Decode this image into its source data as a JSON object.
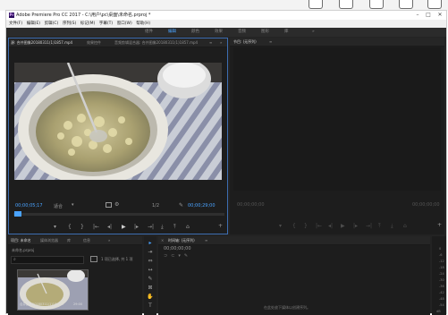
{
  "app": {
    "title": "Adobe Premiere Pro CC 2017 - C:\\用户\\pc\\桌面\\未命名.prproj *",
    "logo_text": "Pr",
    "minimize": "–",
    "maximize": "□",
    "close": "✕"
  },
  "menu": [
    "文件(F)",
    "编辑(E)",
    "剪辑(C)",
    "序列(S)",
    "标记(M)",
    "字幕(T)",
    "窗口(W)",
    "帮助(H)"
  ],
  "workspaces": {
    "items": [
      "组件",
      "编辑",
      "颜色",
      "效果",
      "音频",
      "图形",
      "库"
    ],
    "active_index": 1,
    "more": "»"
  },
  "source_panel": {
    "tabs": [
      "源: 合并图像20180311(1)1857.mp4",
      "效果控件",
      "音频剪辑混合器: 合并图像20180311(1)1857.mp4"
    ],
    "menu_icon": "≡",
    "more": "»",
    "timecode_in": "00;00;05;17",
    "fit": "适合",
    "zoom": "1/2",
    "timecode_out": "00;00;29;00",
    "controls": [
      "▾",
      "{",
      "}",
      "|←",
      "◂|",
      "▶",
      "|▸",
      "→|",
      "⤓",
      "⤒",
      "⌂",
      "+"
    ]
  },
  "program_panel": {
    "title": "节目: (无序列)",
    "menu_icon": "≡",
    "timecode_in": "00;00;00;00",
    "timecode_out": "00;00;00;00",
    "controls": [
      "▾",
      "{",
      "}",
      "|←",
      "◂|",
      "▶",
      "|▸",
      "→|",
      "⤒",
      "⤓",
      "⌂",
      "+"
    ]
  },
  "project_panel": {
    "tabs": [
      "项目: 未命名",
      "媒体浏览器",
      "库",
      "信息"
    ],
    "more": "»",
    "project_file": "未命名.prproj",
    "search_placeholder": "",
    "items_count": "1 项已选择, 共 1 项",
    "thumb_label": "合并图像20180311(1)1857...",
    "thumb_duration": "29:00"
  },
  "tools": [
    "▸",
    "⇥",
    "⇔",
    "↔",
    "✎",
    "⊠",
    "✋",
    "T"
  ],
  "timeline_panel": {
    "close": "×",
    "title": "时间轴: (无序列)",
    "menu_icon": "≡",
    "timecode": "00;00;00;00",
    "empty_hint": "在此处放下媒体以创建序列。"
  },
  "audio_meter": {
    "labels": [
      "0",
      "-6",
      "-12",
      "-18",
      "-24",
      "-30",
      "-36",
      "-42",
      "-48",
      "-54"
    ],
    "bottom": "dB"
  },
  "colors": {
    "accent": "#4aa3ff",
    "panel_bg": "#1d1d1d",
    "app_bg": "#232323"
  }
}
